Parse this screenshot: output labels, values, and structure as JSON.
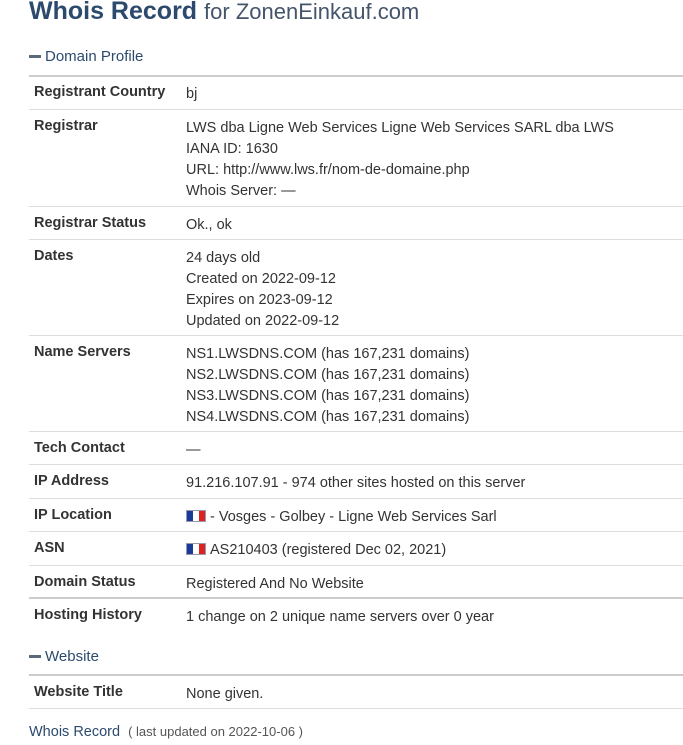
{
  "title": {
    "main": "Whois Record",
    "suffix": "for ZonenEinkauf.com"
  },
  "sections": {
    "domain_profile": "Domain Profile",
    "website": "Website"
  },
  "profile": {
    "registrant_country": {
      "label": "Registrant Country",
      "value": "bj"
    },
    "registrar": {
      "label": "Registrar",
      "line1": "LWS dba Ligne Web Services Ligne Web Services SARL dba LWS",
      "line2": "IANA ID: 1630",
      "line3": "URL: http://www.lws.fr/nom-de-domaine.php",
      "line4": "Whois Server: —"
    },
    "registrar_status": {
      "label": "Registrar Status",
      "value": "Ok., ok"
    },
    "dates": {
      "label": "Dates",
      "age": "24 days old",
      "created": "Created on 2022-09-12",
      "expires": "Expires on 2023-09-12",
      "updated": "Updated on 2022-09-12"
    },
    "name_servers": {
      "label": "Name Servers",
      "ns1": "NS1.LWSDNS.COM (has 167,231 domains)",
      "ns2": "NS2.LWSDNS.COM (has 167,231 domains)",
      "ns3": "NS3.LWSDNS.COM (has 167,231 domains)",
      "ns4": "NS4.LWSDNS.COM (has 167,231 domains)"
    },
    "tech_contact": {
      "label": "Tech Contact",
      "value": "—"
    },
    "ip_address": {
      "label": "IP Address",
      "value": "91.216.107.91 - 974 other sites hosted on this server"
    },
    "ip_location": {
      "label": "IP Location",
      "value": "- Vosges - Golbey - Ligne Web Services Sarl",
      "flag": "france-flag-icon"
    },
    "asn": {
      "label": "ASN",
      "value": "AS210403 (registered Dec 02, 2021)",
      "flag": "france-flag-icon"
    },
    "domain_status": {
      "label": "Domain Status",
      "value": "Registered And No Website"
    },
    "hosting_history": {
      "label": "Hosting History",
      "value": "1 change on 2 unique name servers over 0 year"
    }
  },
  "website": {
    "title": {
      "label": "Website Title",
      "value": "None given."
    }
  },
  "footer": {
    "link": "Whois Record",
    "updated": "( last updated on 2022-10-06 )"
  },
  "colors": {
    "heading": "#2c4a6e",
    "text": "#333333",
    "rule": "#cccccc"
  }
}
